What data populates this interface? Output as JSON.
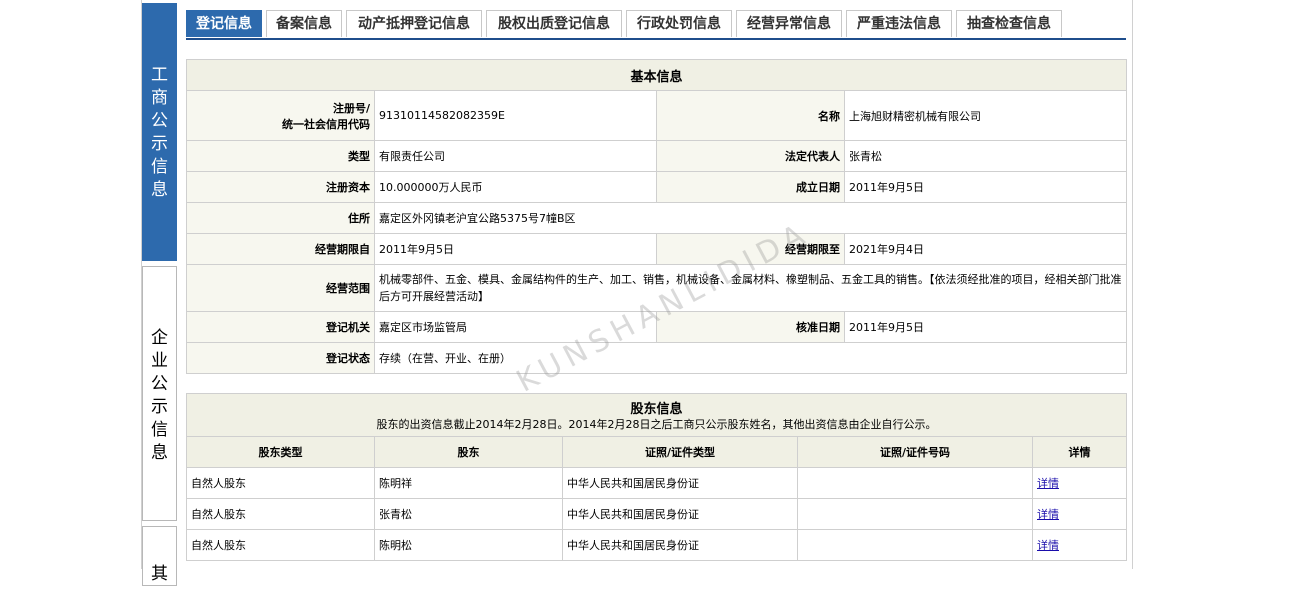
{
  "sidebar": {
    "items": [
      {
        "label": [
          "工",
          "商",
          "公",
          "示",
          "信",
          "息"
        ],
        "active": true
      },
      {
        "label": [
          "企",
          "业",
          "公",
          "示",
          "信",
          "息"
        ],
        "active": false
      },
      {
        "label": [
          "其"
        ],
        "active": false
      }
    ]
  },
  "tabs": [
    "登记信息",
    "备案信息",
    "动产抵押登记信息",
    "股权出质登记信息",
    "行政处罚信息",
    "经营异常信息",
    "严重违法信息",
    "抽查检查信息"
  ],
  "basic": {
    "caption": "基本信息",
    "reg_label_1": "注册号/",
    "reg_label_2": "统一社会信用代码",
    "reg_value": "91310114582082359E",
    "name_label": "名称",
    "name_value": "上海旭财精密机械有限公司",
    "type_label": "类型",
    "type_value": "有限责任公司",
    "legal_label": "法定代表人",
    "legal_value": "张青松",
    "capital_label": "注册资本",
    "capital_value": "10.000000万人民币",
    "founded_label": "成立日期",
    "founded_value": "2011年9月5日",
    "address_label": "住所",
    "address_value": "嘉定区外冈镇老沪宜公路5375号7幢B区",
    "term_from_label": "经营期限自",
    "term_from_value": "2011年9月5日",
    "term_to_label": "经营期限至",
    "term_to_value": "2021年9月4日",
    "scope_label": "经营范围",
    "scope_value": "机械零部件、五金、模具、金属结构件的生产、加工、销售，机械设备、金属材料、橡塑制品、五金工具的销售。【依法须经批准的项目，经相关部门批准后方可开展经营活动】",
    "authority_label": "登记机关",
    "authority_value": "嘉定区市场监管局",
    "approved_label": "核准日期",
    "approved_value": "2011年9月5日",
    "status_label": "登记状态",
    "status_value": "存续（在营、开业、在册）"
  },
  "shareholders": {
    "caption": "股东信息",
    "note": "股东的出资信息截止2014年2月28日。2014年2月28日之后工商只公示股东姓名，其他出资信息由企业自行公示。",
    "headers": [
      "股东类型",
      "股东",
      "证照/证件类型",
      "证照/证件号码",
      "详情"
    ],
    "rows": [
      {
        "type": "自然人股东",
        "name": "陈明祥",
        "id_type": "中华人民共和国居民身份证",
        "id_no": "",
        "detail": "详情"
      },
      {
        "type": "自然人股东",
        "name": "张青松",
        "id_type": "中华人民共和国居民身份证",
        "id_no": "",
        "detail": "详情"
      },
      {
        "type": "自然人股东",
        "name": "陈明松",
        "id_type": "中华人民共和国居民身份证",
        "id_no": "",
        "detail": "详情"
      }
    ]
  },
  "watermark": "KUNSHANLIDIDA"
}
